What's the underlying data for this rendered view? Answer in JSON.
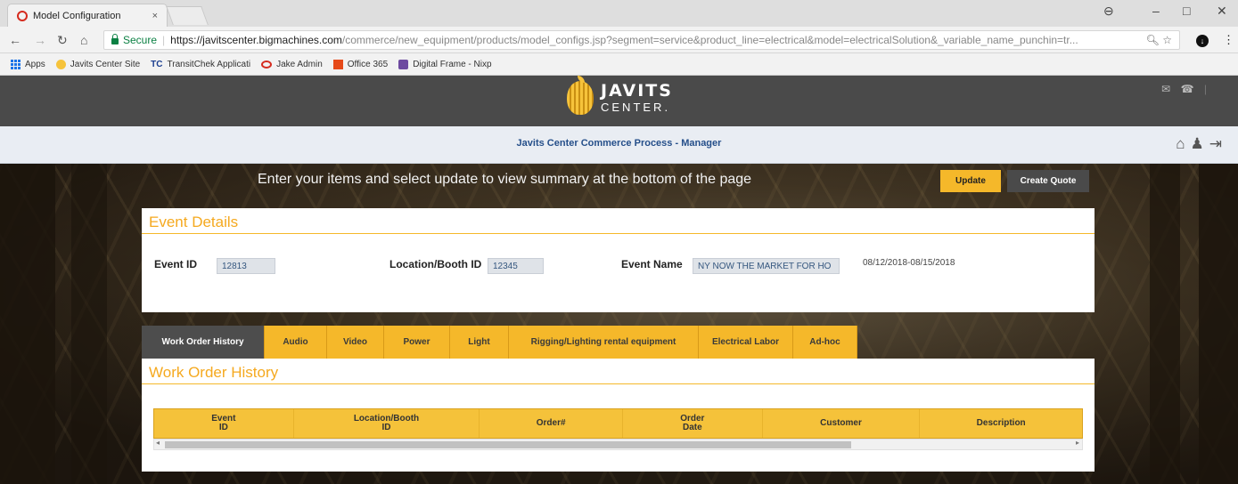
{
  "browser": {
    "tab_title": "Model Configuration",
    "tab_close": "×",
    "secure_label": "Secure",
    "url_host": "https://javitscenter.bigmachines.com",
    "url_path": "/commerce/new_equipment/products/model_configs.jsp?segment=service&product_line=electrical&model=electricalSolution&_variable_name_punchin=tr...",
    "bookmarks": [
      {
        "label": "Apps",
        "icon": "apps-icon"
      },
      {
        "label": "Javits Center Site",
        "icon": "javits-favicon"
      },
      {
        "label": "TransitChek Applicati",
        "icon": "tc-icon"
      },
      {
        "label": "Jake Admin",
        "icon": "oracle-icon"
      },
      {
        "label": "Office 365",
        "icon": "office-icon"
      },
      {
        "label": "Digital Frame - Nixp",
        "icon": "frame-icon"
      }
    ]
  },
  "header": {
    "logo_line1": "JAVITS",
    "logo_line2": "CENTER."
  },
  "subheader": {
    "title": "Javits Center Commerce Process - Manager"
  },
  "main": {
    "instruction": "Enter your items and select update to view summary at the bottom of the page",
    "update_label": "Update",
    "create_quote_label": "Create Quote"
  },
  "event_details": {
    "title": "Event Details",
    "event_id_label": "Event ID",
    "event_id_value": "12813",
    "location_label": "Location/Booth ID",
    "location_value": "12345",
    "event_name_label": "Event Name",
    "event_name_value": "NY NOW THE MARKET FOR HO",
    "date_range": "08/12/2018-08/15/2018"
  },
  "tabs": [
    {
      "label": "Work Order History",
      "active": true
    },
    {
      "label": "Audio"
    },
    {
      "label": "Video"
    },
    {
      "label": "Power"
    },
    {
      "label": "Light"
    },
    {
      "label": "Rigging/Lighting rental equipment"
    },
    {
      "label": "Electrical Labor"
    },
    {
      "label": "Ad-hoc"
    }
  ],
  "work_order_history": {
    "title": "Work Order History",
    "columns": [
      [
        "Event",
        "ID"
      ],
      [
        "Location/Booth",
        "ID"
      ],
      [
        "Order#",
        ""
      ],
      [
        "Order",
        "Date"
      ],
      [
        "Customer",
        ""
      ],
      [
        "Description",
        ""
      ]
    ]
  },
  "colors": {
    "accent_yellow": "#f5b82a",
    "header_dark": "#4a4a4a",
    "title_orange": "#f5a91f",
    "subtitle_blue": "#254f8a"
  }
}
